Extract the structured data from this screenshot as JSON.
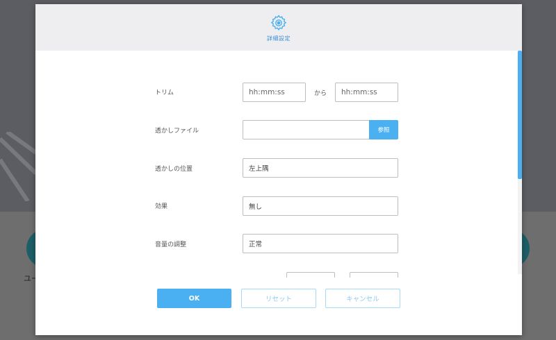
{
  "background": {
    "partial_text": "ユー"
  },
  "dialog": {
    "title": "詳細設定",
    "icon": "gear-icon",
    "accent_color": "#4ab0f2",
    "rows": {
      "trim": {
        "label": "トリム",
        "start_placeholder": "hh:mm:ss",
        "separator": "から",
        "end_placeholder": "hh:mm:ss"
      },
      "watermark_file": {
        "label": "透かしファイル",
        "value": "",
        "browse_label": "参照"
      },
      "watermark_position": {
        "label": "透かしの位置",
        "value": "左上隅"
      },
      "effect": {
        "label": "効果",
        "value": "無し"
      },
      "volume": {
        "label": "音量の調整",
        "value": "正常"
      }
    },
    "buttons": {
      "ok": "OK",
      "reset": "リセット",
      "cancel": "キャンセル"
    }
  }
}
